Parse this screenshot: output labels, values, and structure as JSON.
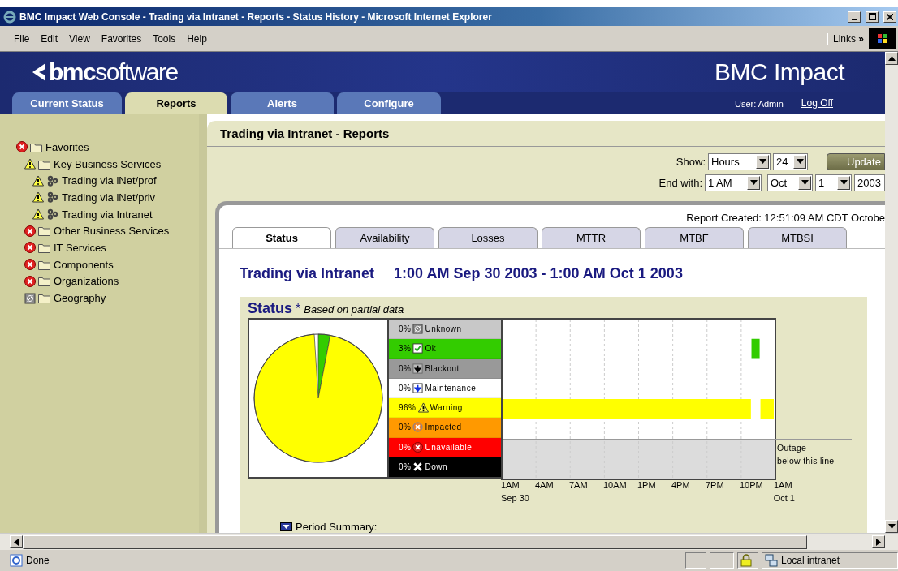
{
  "window": {
    "title": "BMC Impact Web Console - Trading via Intranet - Reports - Status History - Microsoft Internet Explorer"
  },
  "menu": [
    "File",
    "Edit",
    "View",
    "Favorites",
    "Tools",
    "Help"
  ],
  "links": {
    "label": "Links",
    "more": "»"
  },
  "banner": {
    "logo": "**bmc**software",
    "product": "BMC Impact"
  },
  "nav_tabs": [
    {
      "label": "Current Status",
      "selected": false
    },
    {
      "label": "Reports",
      "selected": true
    },
    {
      "label": "Alerts",
      "selected": false
    },
    {
      "label": "Configure",
      "selected": false
    }
  ],
  "user": {
    "label": "User: Admin",
    "logoff": "Log Off"
  },
  "sidebar": {
    "tree": [
      {
        "label": "Favorites",
        "icons": [
          {
            "kind": "unavailable"
          },
          {
            "kind": "folder"
          }
        ],
        "children": [
          {
            "label": "Key Business Services",
            "icons": [
              {
                "kind": "warning"
              },
              {
                "kind": "folder"
              }
            ],
            "children": [
              {
                "label": "Trading via iNet/prof",
                "icons": [
                  {
                    "kind": "warning"
                  },
                  {
                    "kind": "service"
                  }
                ]
              },
              {
                "label": "Trading via iNet/priv",
                "icons": [
                  {
                    "kind": "warning"
                  },
                  {
                    "kind": "service"
                  }
                ]
              },
              {
                "label": "Trading via Intranet",
                "icons": [
                  {
                    "kind": "warning"
                  },
                  {
                    "kind": "service"
                  }
                ]
              }
            ]
          },
          {
            "label": "Other Business Services",
            "icons": [
              {
                "kind": "unavailable"
              },
              {
                "kind": "folder"
              }
            ]
          },
          {
            "label": "IT Services",
            "icons": [
              {
                "kind": "unavailable"
              },
              {
                "kind": "folder"
              }
            ]
          },
          {
            "label": "Components",
            "icons": [
              {
                "kind": "unavailable"
              },
              {
                "kind": "folder"
              }
            ]
          },
          {
            "label": "Organizations",
            "icons": [
              {
                "kind": "unavailable"
              },
              {
                "kind": "folder"
              }
            ]
          },
          {
            "label": "Geography",
            "icons": [
              {
                "kind": "unknown"
              },
              {
                "kind": "folder"
              }
            ]
          }
        ]
      }
    ]
  },
  "page_title": "Trading via Intranet - Reports",
  "controls": {
    "show_label": "Show:",
    "show_unit": "Hours",
    "show_count": "24",
    "update": "Update",
    "end_label": "End with:",
    "end_hour": "1 AM",
    "end_month": "Oct",
    "end_day": "1",
    "end_year": "2003"
  },
  "report_created": "Report Created: 12:51:09 AM CDT Octobe",
  "report_tabs": [
    {
      "label": "Status",
      "selected": true
    },
    {
      "label": "Availability",
      "selected": false
    },
    {
      "label": "Losses",
      "selected": false
    },
    {
      "label": "MTTR",
      "selected": false
    },
    {
      "label": "MTBF",
      "selected": false
    },
    {
      "label": "MTBSI",
      "selected": false
    }
  ],
  "report_heading": {
    "subject": "Trading via Intranet",
    "range": "1:00 AM Sep 30 2003 - 1:00 AM Oct 1 2003"
  },
  "status_section": {
    "title": "Status",
    "asterisk": "*",
    "note": "Based on partial data"
  },
  "legend": [
    {
      "kind": "unknown",
      "percent": "0%",
      "color": "#c8c8c8"
    },
    {
      "kind": "ok",
      "percent": "3%",
      "color": "#33cc00"
    },
    {
      "kind": "blackout",
      "percent": "0%",
      "color": "#999999"
    },
    {
      "kind": "maintenance",
      "percent": "0%",
      "color": "#ffffff"
    },
    {
      "kind": "warning",
      "percent": "96%",
      "color": "#ffff00"
    },
    {
      "kind": "impacted",
      "percent": "0%",
      "color": "#ff9900"
    },
    {
      "kind": "unavailable",
      "percent": "0%",
      "color": "#ff0000"
    },
    {
      "kind": "down",
      "percent": "0%",
      "color": "#000000"
    }
  ],
  "pie": {
    "chart_data": {
      "type": "pie",
      "categories": [
        "Unknown",
        "Ok",
        "Blackout",
        "Maintenance",
        "Warning",
        "Impacted",
        "Unavailable",
        "Down"
      ],
      "values": [
        0,
        3,
        0,
        0,
        96,
        0,
        0,
        0
      ]
    }
  },
  "timeline": {
    "ticks": [
      "1AM",
      "4AM",
      "7AM",
      "10AM",
      "1PM",
      "4PM",
      "7PM",
      "10PM",
      "1AM"
    ],
    "start_date": "Sep 30",
    "end_date": "Oct 1",
    "outage_label": "Outage\nbelow this line"
  },
  "period_summary": "Period Summary:",
  "status_bar": {
    "text": "Done",
    "zone": "Local intranet"
  }
}
